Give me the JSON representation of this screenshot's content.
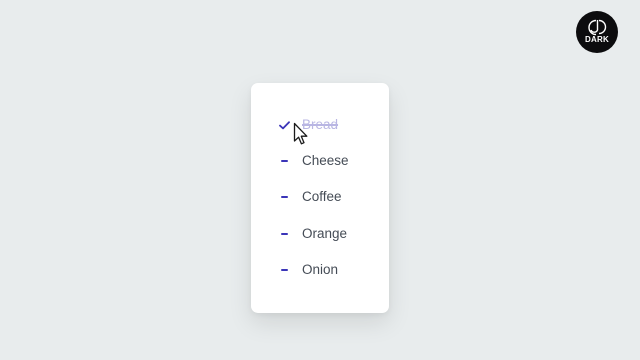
{
  "todo": {
    "items": [
      {
        "label": "Bread",
        "done": true,
        "mark_icon": "check-icon"
      },
      {
        "label": "Cheese",
        "done": false,
        "mark_icon": "dash-icon"
      },
      {
        "label": "Coffee",
        "done": false,
        "mark_icon": "dash-icon"
      },
      {
        "label": "Orange",
        "done": false,
        "mark_icon": "dash-icon"
      },
      {
        "label": "Onion",
        "done": false,
        "mark_icon": "dash-icon"
      }
    ]
  },
  "logo": {
    "text": "DARK",
    "icon": "cd-logo-icon"
  },
  "colors": {
    "background": "#e8eced",
    "card": "#ffffff",
    "accent": "#3b35b8",
    "text": "#454c56",
    "done_text": "#b9b6e3",
    "logo_bg": "#0c0c0e"
  }
}
